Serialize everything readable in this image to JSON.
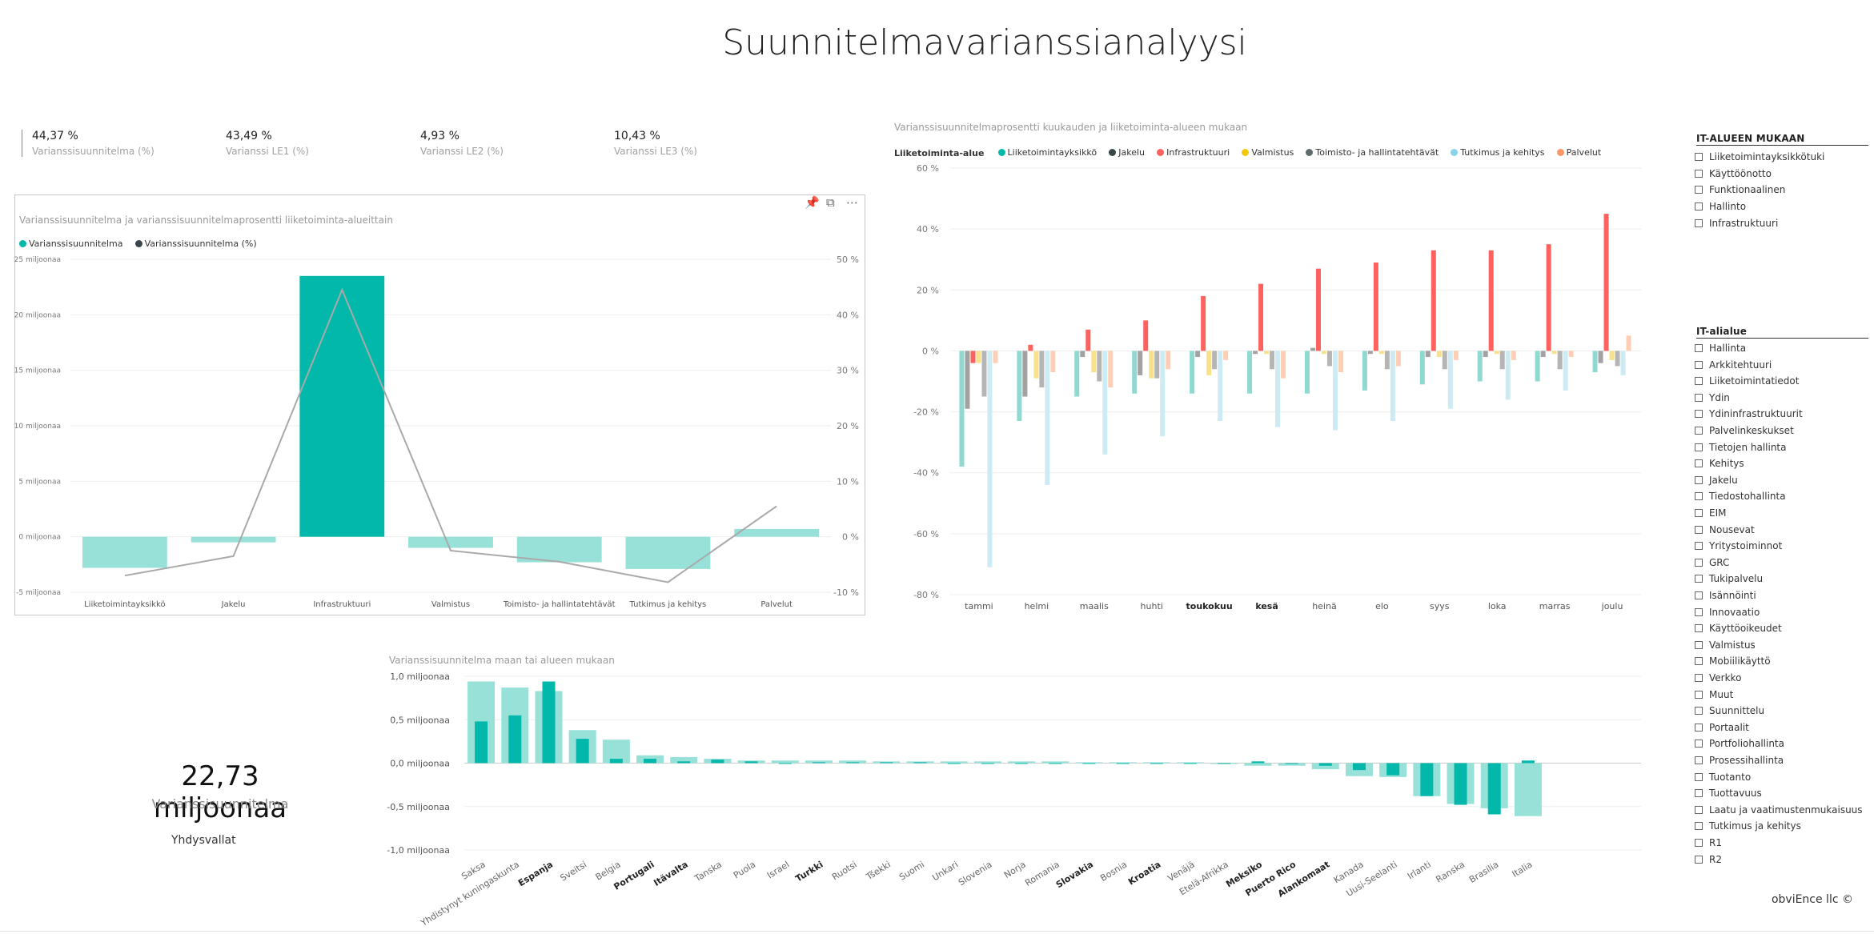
{
  "title": "Suunnitelmavarianssianalyysi",
  "kpis": [
    {
      "value": "44,37 %",
      "label": "Varianssisuunnitelma (%)"
    },
    {
      "value": "43,49 %",
      "label": "Varianssi LE1 (%)"
    },
    {
      "value": "4,93 %",
      "label": "Varianssi LE2 (%)"
    },
    {
      "value": "10,43 %",
      "label": "Varianssi LE3 (%)"
    }
  ],
  "combo_header_icons": [
    "pin-icon",
    "focus-mode-icon",
    "more-options-icon"
  ],
  "card": {
    "value": "22,73 miljoonaa",
    "label": "Varianssisuunnitelma",
    "filter": "Yhdysvallat"
  },
  "footer": "obviEnce llc ©",
  "slicer_area": {
    "title": "IT-ALUEEN MUKAAN",
    "items": [
      "Liiketoimintayksikkötuki",
      "Käyttöönotto",
      "Funktionaalinen",
      "Hallinto",
      "Infrastruktuuri"
    ]
  },
  "slicer_subarea": {
    "title": "IT-alialue",
    "items": [
      "Hallinta",
      "Arkkitehtuuri",
      "Liiketoimintatiedot",
      "Ydin",
      "Ydininfrastruktuurit",
      "Palvelinkeskukset",
      "Tietojen hallinta",
      "Kehitys",
      "Jakelu",
      "Tiedostohallinta",
      "EIM",
      "Nousevat",
      "Yritystoiminnot",
      "GRC",
      "Tukipalvelu",
      "Isännöinti",
      "Innovaatio",
      "Käyttöoikeudet",
      "Valmistus",
      "Mobiilikäyttö",
      "Verkko",
      "Muut",
      "Suunnittelu",
      "Portaalit",
      "Portfoliohallinta",
      "Prosessihallinta",
      "Tuotanto",
      "Tuottavuus",
      "Laatu ja vaatimustenmukaisuus",
      "Tutkimus ja kehitys",
      "R1",
      "R2"
    ]
  },
  "chart_data": [
    {
      "type": "bar",
      "title": "Varianssisuunnitelma ja varianssisuunnitelmaprosentti liiketoiminta-alueittain",
      "categories": [
        "Liiketoimintayksikkö",
        "Jakelu",
        "Infrastruktuuri",
        "Valmistus",
        "Toimisto- ja hallintatehtävät",
        "Tutkimus ja kehitys",
        "Palvelut"
      ],
      "series": [
        {
          "name": "Varianssisuunnitelma",
          "kind": "bar",
          "axis": "left",
          "color": "#01b8aa",
          "values": [
            -2.8,
            -0.5,
            23.5,
            -1.0,
            -2.3,
            -2.9,
            0.7
          ]
        },
        {
          "name": "Varianssisuunnitelma (%)",
          "kind": "line",
          "axis": "right",
          "color": "#a9a9a9",
          "values": [
            -7,
            -3.5,
            44.5,
            -2.5,
            -4.5,
            -8.2,
            5.5
          ]
        }
      ],
      "y_left_ticks": [
        {
          "v": 25,
          "label": "25 miljoonaa"
        },
        {
          "v": 20,
          "label": "20 miljoonaa"
        },
        {
          "v": 15,
          "label": "15 miljoonaa"
        },
        {
          "v": 10,
          "label": "10 miljoonaa"
        },
        {
          "v": 5,
          "label": "5 miljoonaa"
        },
        {
          "v": 0,
          "label": "0 miljoonaa"
        },
        {
          "v": -5,
          "label": "-5 miljoonaa"
        }
      ],
      "y_right_ticks": [
        {
          "v": 50,
          "label": "50 %"
        },
        {
          "v": 40,
          "label": "40 %"
        },
        {
          "v": 30,
          "label": "30 %"
        },
        {
          "v": 20,
          "label": "20 %"
        },
        {
          "v": 10,
          "label": "10 %"
        },
        {
          "v": 0,
          "label": "0 %"
        },
        {
          "v": -10,
          "label": "-10 %"
        }
      ],
      "ylim_left": [
        -5,
        25
      ],
      "ylim_right": [
        -10,
        50
      ],
      "legend_position": "top-left",
      "grid": true
    },
    {
      "type": "bar",
      "title": "Varianssisuunnitelmaprosentti kuukauden ja liiketoiminta-alueen mukaan",
      "legend_title": "Liiketoiminta-alue",
      "categories": [
        "tammi",
        "helmi",
        "maalis",
        "huhti",
        "toukokuu",
        "kesä",
        "heinä",
        "elo",
        "syys",
        "loka",
        "marras",
        "joulu"
      ],
      "series": [
        {
          "name": "Liiketoimintayksikkö",
          "legend_color": "#01b8aa",
          "bar_color": "#8fd9d1",
          "values": [
            -38,
            -23,
            -15,
            -14,
            -14,
            -14,
            -14,
            -13,
            -11,
            -10,
            -10,
            -7
          ]
        },
        {
          "name": "Jakelu",
          "legend_color": "#374649",
          "bar_color": "#a2a2a2",
          "values": [
            -19,
            -15,
            -2,
            -8,
            -2,
            -1,
            1,
            -1,
            -2,
            -2,
            -2,
            -4
          ]
        },
        {
          "name": "Infrastruktuuri",
          "legend_color": "#fd625e",
          "bar_color": "#fd625e",
          "values": [
            -4,
            2,
            7,
            10,
            18,
            22,
            27,
            29,
            33,
            33,
            35,
            45
          ]
        },
        {
          "name": "Valmistus",
          "legend_color": "#f2c80f",
          "bar_color": "#f7e28b",
          "values": [
            -4,
            -9,
            -7,
            -9,
            -8,
            -1,
            -1,
            -1,
            -2,
            -1,
            -1,
            -3
          ]
        },
        {
          "name": "Toimisto- ja hallintatehtävät",
          "legend_color": "#5f6b6d",
          "bar_color": "#b5b5b5",
          "values": [
            -15,
            -12,
            -10,
            -9,
            -6,
            -6,
            -5,
            -6,
            -6,
            -6,
            -6,
            -5
          ]
        },
        {
          "name": "Tutkimus ja kehitys",
          "legend_color": "#8ad4eb",
          "bar_color": "#cdebf5",
          "values": [
            -71,
            -44,
            -34,
            -28,
            -23,
            -25,
            -26,
            -23,
            -19,
            -16,
            -13,
            -8
          ]
        },
        {
          "name": "Palvelut",
          "legend_color": "#fe9666",
          "bar_color": "#fecfb5",
          "values": [
            -4,
            -7,
            -12,
            -6,
            -3,
            -9,
            -7,
            -5,
            -3,
            -3,
            -2,
            5
          ]
        }
      ],
      "y_ticks": [
        {
          "v": 60,
          "label": "60 %"
        },
        {
          "v": 40,
          "label": "40 %"
        },
        {
          "v": 20,
          "label": "20 %"
        },
        {
          "v": 0,
          "label": "0 %"
        },
        {
          "v": -20,
          "label": "-20 %"
        },
        {
          "v": -40,
          "label": "-40 %"
        },
        {
          "v": -60,
          "label": "-60 %"
        },
        {
          "v": -80,
          "label": "-80 %"
        }
      ],
      "bold_categories": [
        "toukokuu",
        "kesä"
      ],
      "ylim": [
        -80,
        60
      ],
      "legend_position": "top-left",
      "grid": true
    },
    {
      "type": "bar",
      "title": "Varianssisuunnitelma maan tai alueen mukaan",
      "categories": [
        "Saksa",
        "Yhdistynyt kuningaskunta",
        "Espanja",
        "Sveitsi",
        "Belgia",
        "Portugali",
        "Itävalta",
        "Tanska",
        "Puola",
        "Israel",
        "Turkki",
        "Ruotsi",
        "Tšekki",
        "Suomi",
        "Unkari",
        "Slovenia",
        "Norja",
        "Romania",
        "Slovakia",
        "Bosnia",
        "Kroatia",
        "Venäjä",
        "Etelä-Afrikka",
        "Meksiko",
        "Puerto Rico",
        "Alankomaat",
        "Kanada",
        "Uusi-Seelanti",
        "Irlanti",
        "Ranska",
        "Brasilia",
        "Italia"
      ],
      "series": [
        {
          "name": "Tausta",
          "color": "#97e1d9",
          "values": [
            0.94,
            0.87,
            0.83,
            0.38,
            0.27,
            0.09,
            0.07,
            0.05,
            0.03,
            0.03,
            0.03,
            0.03,
            0.02,
            0.02,
            0.02,
            0.02,
            0.02,
            0.02,
            0.01,
            0.01,
            0.01,
            0.01,
            -0.01,
            -0.03,
            -0.03,
            -0.07,
            -0.15,
            -0.16,
            -0.38,
            -0.47,
            -0.52,
            -0.61
          ]
        },
        {
          "name": "Etualue",
          "color": "#01b8aa",
          "values": [
            0.48,
            0.55,
            0.94,
            0.28,
            0.05,
            0.05,
            0.02,
            0.04,
            0.02,
            0.0,
            0.01,
            0.01,
            0.01,
            0.01,
            0.0,
            0.0,
            0.0,
            0.0,
            0.0,
            0.0,
            0.0,
            0.0,
            0.0,
            0.02,
            0.0,
            -0.03,
            -0.08,
            -0.14,
            -0.38,
            -0.48,
            -0.59,
            0.03
          ]
        }
      ],
      "bold_categories": [
        "Espanja",
        "Portugali",
        "Itävalta",
        "Turkki",
        "Slovakia",
        "Kroatia",
        "Meksiko",
        "Puerto Rico",
        "Alankomaat"
      ],
      "y_ticks": [
        {
          "v": 1.0,
          "label": "1,0 miljoonaa"
        },
        {
          "v": 0.5,
          "label": "0,5 miljoonaa"
        },
        {
          "v": 0.0,
          "label": "0,0 miljoonaa"
        },
        {
          "v": -0.5,
          "label": "-0,5 miljoonaa"
        },
        {
          "v": -1.0,
          "label": "-1,0 miljoonaa"
        }
      ],
      "ylim": [
        -1.0,
        1.0
      ],
      "grid": true
    }
  ]
}
